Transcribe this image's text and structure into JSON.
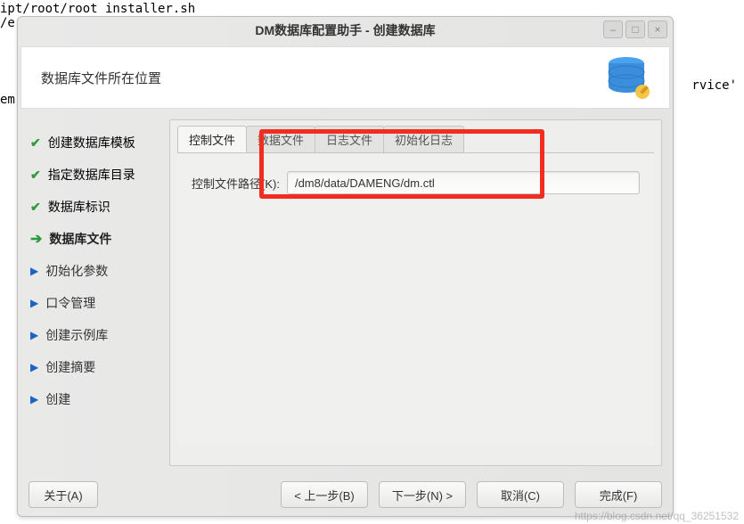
{
  "background": {
    "line1": "ipt/root/root installer.sh",
    "line2": "/e",
    "line3": "rvice'",
    "line4": "em"
  },
  "dialog": {
    "title": "DM数据库配置助手 - 创建数据库",
    "header_title": "数据库文件所在位置"
  },
  "sidebar": {
    "items": [
      {
        "label": "创建数据库模板",
        "state": "done"
      },
      {
        "label": "指定数据库目录",
        "state": "done"
      },
      {
        "label": "数据库标识",
        "state": "done"
      },
      {
        "label": "数据库文件",
        "state": "current"
      },
      {
        "label": "初始化参数",
        "state": "pending"
      },
      {
        "label": "口令管理",
        "state": "pending"
      },
      {
        "label": "创建示例库",
        "state": "pending"
      },
      {
        "label": "创建摘要",
        "state": "pending"
      },
      {
        "label": "创建",
        "state": "pending"
      }
    ]
  },
  "tabs": {
    "items": [
      "控制文件",
      "数据文件",
      "日志文件",
      "初始化日志"
    ],
    "active_index": 0
  },
  "form": {
    "control_path_label": "控制文件路径(K):",
    "control_path_value": "/dm8/data/DAMENG/dm.ctl"
  },
  "footer": {
    "about": "关于(A)",
    "back": "< 上一步(B)",
    "next": "下一步(N) >",
    "cancel": "取消(C)",
    "finish": "完成(F)"
  },
  "watermark": "https://blog.csdn.net/qq_36251532"
}
